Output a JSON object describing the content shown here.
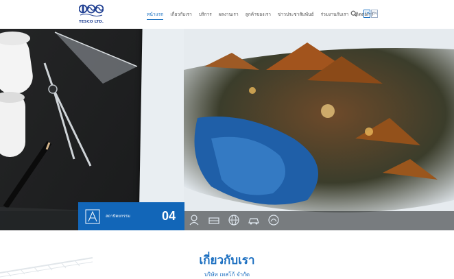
{
  "logo": {
    "text": "TESCO LTD."
  },
  "nav": {
    "items": [
      {
        "label": "หน้าแรก",
        "active": true
      },
      {
        "label": "เกี่ยวกับเรา"
      },
      {
        "label": "บริการ"
      },
      {
        "label": "ผลงานเรา"
      },
      {
        "label": "ลูกค้าของเรา"
      },
      {
        "label": "ข่าวประชาสัมพันธ์"
      },
      {
        "label": "ร่วมงานกับเรา"
      },
      {
        "label": "ติดต่อเรา"
      }
    ],
    "lang_th": "TH",
    "lang_en": "EN"
  },
  "hero": {
    "category_label": "สถาปัตยกรรม",
    "category_number": "04"
  },
  "about": {
    "title": "เกี่ยวกับเรา",
    "subtitle": "บริษัท เทสโก้ จำกัด"
  },
  "colors": {
    "accent": "#1266b8",
    "brand": "#1f3f92"
  }
}
